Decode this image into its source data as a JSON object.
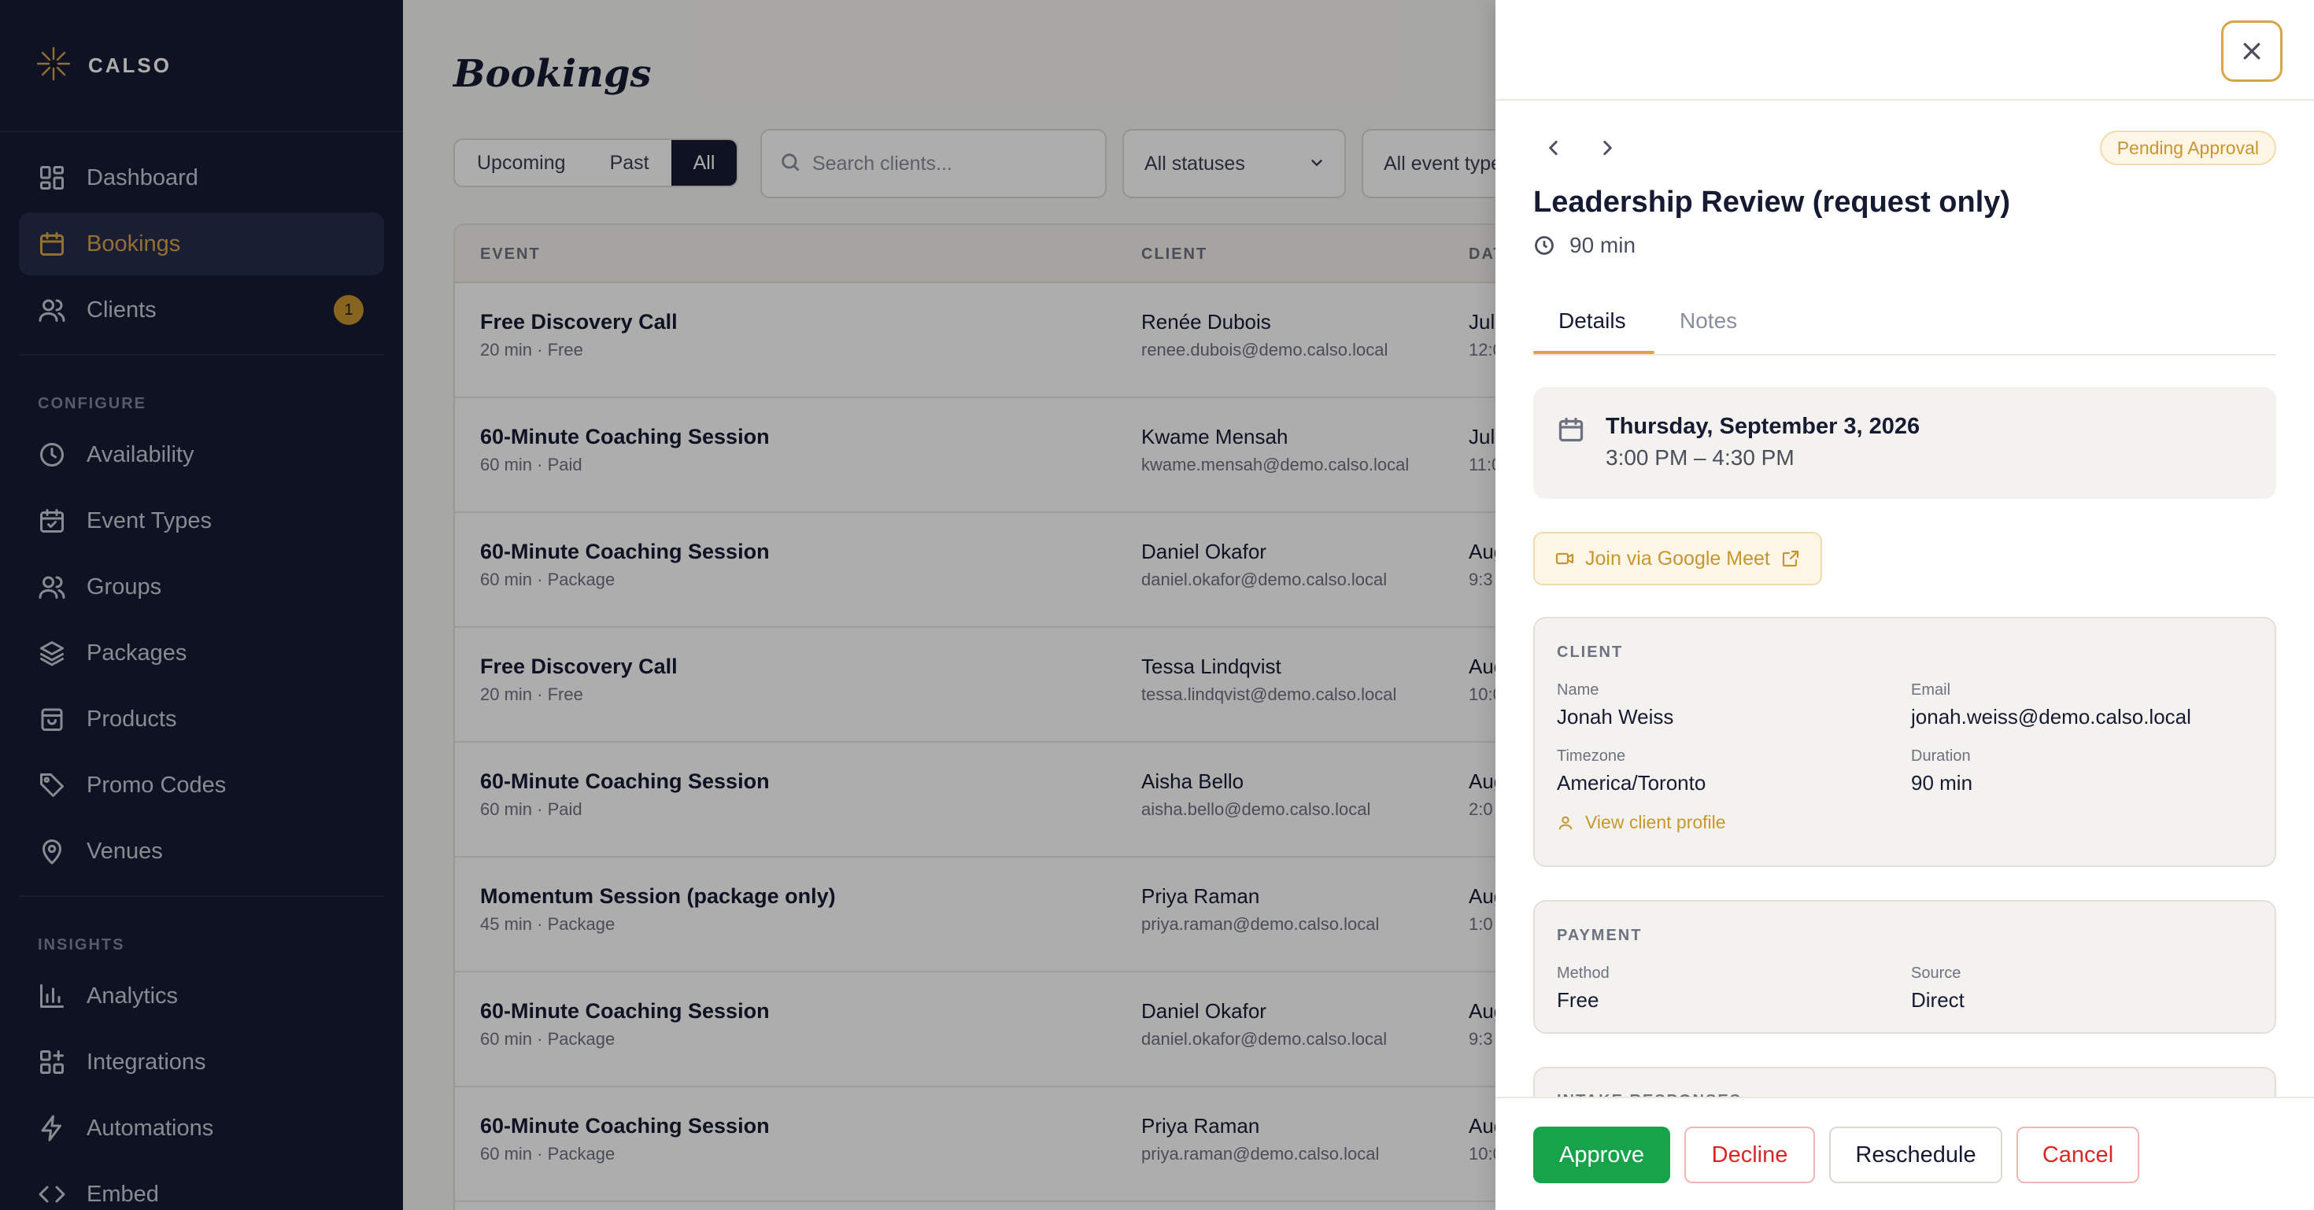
{
  "brand": {
    "name": "CALSO"
  },
  "sidebar": {
    "items": [
      {
        "label": "Dashboard",
        "icon": "dashboard-icon"
      },
      {
        "label": "Bookings",
        "icon": "calendar-icon",
        "active": true
      },
      {
        "label": "Clients",
        "icon": "users-icon",
        "badge": "1"
      }
    ],
    "configure_label": "CONFIGURE",
    "configure": [
      {
        "label": "Availability",
        "icon": "clock-icon"
      },
      {
        "label": "Event Types",
        "icon": "calendar-check-icon"
      },
      {
        "label": "Groups",
        "icon": "users-icon"
      },
      {
        "label": "Packages",
        "icon": "layers-icon"
      },
      {
        "label": "Products",
        "icon": "bag-icon"
      },
      {
        "label": "Promo Codes",
        "icon": "tag-icon"
      },
      {
        "label": "Venues",
        "icon": "map-pin-icon"
      }
    ],
    "insights_label": "INSIGHTS",
    "insights": [
      {
        "label": "Analytics",
        "icon": "bar-chart-icon"
      },
      {
        "label": "Integrations",
        "icon": "grid-plus-icon"
      },
      {
        "label": "Automations",
        "icon": "zap-icon"
      },
      {
        "label": "Embed",
        "icon": "code-icon"
      }
    ]
  },
  "main": {
    "title": "Bookings",
    "filter_tabs": [
      "Upcoming",
      "Past",
      "All"
    ],
    "active_filter": "All",
    "search_placeholder": "Search clients...",
    "status_select": "All statuses",
    "event_select": "All event types",
    "columns": [
      "EVENT",
      "CLIENT",
      "DATE"
    ],
    "rows": [
      {
        "event": "Free Discovery Call",
        "meta": "20 min · Free",
        "client": "Renée Dubois",
        "email": "renee.dubois@demo.calso.local",
        "date": "Jul",
        "time": "12:0"
      },
      {
        "event": "60-Minute Coaching Session",
        "meta": "60 min · Paid",
        "client": "Kwame Mensah",
        "email": "kwame.mensah@demo.calso.local",
        "date": "Jul",
        "time": "11:0"
      },
      {
        "event": "60-Minute Coaching Session",
        "meta": "60 min · Package",
        "client": "Daniel Okafor",
        "email": "daniel.okafor@demo.calso.local",
        "date": "Aug",
        "time": "9:3"
      },
      {
        "event": "Free Discovery Call",
        "meta": "20 min · Free",
        "client": "Tessa Lindqvist",
        "email": "tessa.lindqvist@demo.calso.local",
        "date": "Aug",
        "time": "10:0"
      },
      {
        "event": "60-Minute Coaching Session",
        "meta": "60 min · Paid",
        "client": "Aisha Bello",
        "email": "aisha.bello@demo.calso.local",
        "date": "Aug",
        "time": "2:0"
      },
      {
        "event": "Momentum Session (package only)",
        "meta": "45 min · Package",
        "client": "Priya Raman",
        "email": "priya.raman@demo.calso.local",
        "date": "Aug",
        "time": "1:0"
      },
      {
        "event": "60-Minute Coaching Session",
        "meta": "60 min · Package",
        "client": "Daniel Okafor",
        "email": "daniel.okafor@demo.calso.local",
        "date": "Aug",
        "time": "9:3"
      },
      {
        "event": "60-Minute Coaching Session",
        "meta": "60 min · Package",
        "client": "Priya Raman",
        "email": "priya.raman@demo.calso.local",
        "date": "Aug",
        "time": "10:0"
      }
    ]
  },
  "drawer": {
    "status": "Pending Approval",
    "title": "Leadership Review (request only)",
    "duration": "90 min",
    "tabs": [
      "Details",
      "Notes"
    ],
    "active_tab": "Details",
    "date": "Thursday, September 3, 2026",
    "time": "3:00 PM – 4:30 PM",
    "meet_label": "Join via Google Meet",
    "client_section": "CLIENT",
    "client": {
      "name_label": "Name",
      "name": "Jonah Weiss",
      "email_label": "Email",
      "email": "jonah.weiss@demo.calso.local",
      "timezone_label": "Timezone",
      "timezone": "America/Toronto",
      "duration_label": "Duration",
      "duration": "90 min",
      "profile_link": "View client profile"
    },
    "payment_section": "PAYMENT",
    "payment": {
      "method_label": "Method",
      "method": "Free",
      "source_label": "Source",
      "source": "Direct"
    },
    "intake_section": "INTAKE RESPONSES",
    "actions": {
      "approve": "Approve",
      "decline": "Decline",
      "reschedule": "Reschedule",
      "cancel": "Cancel"
    }
  },
  "colors": {
    "sidebar_bg": "#161b33",
    "accent": "#d9a54a",
    "approve": "#16a34a",
    "danger": "#dc2626"
  }
}
